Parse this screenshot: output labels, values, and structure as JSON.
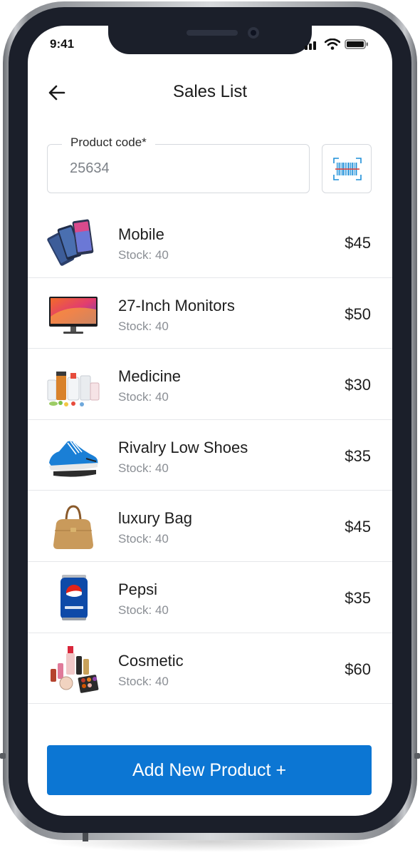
{
  "status_bar": {
    "time": "9:41"
  },
  "header": {
    "title": "Sales List"
  },
  "product_code": {
    "label": "Product code*",
    "value": "25634"
  },
  "products": [
    {
      "name": "Mobile",
      "stock": "Stock: 40",
      "price": "$45",
      "icon": "mobile-phones-image"
    },
    {
      "name": "27-Inch Monitors",
      "stock": "Stock: 40",
      "price": "$50",
      "icon": "monitor-image"
    },
    {
      "name": "Medicine",
      "stock": "Stock: 40",
      "price": "$30",
      "icon": "medicine-image"
    },
    {
      "name": "Rivalry Low Shoes",
      "stock": "Stock: 40",
      "price": "$35",
      "icon": "shoes-image"
    },
    {
      "name": "luxury Bag",
      "stock": "Stock: 40",
      "price": "$45",
      "icon": "bag-image"
    },
    {
      "name": "Pepsi",
      "stock": "Stock: 40",
      "price": "$35",
      "icon": "pepsi-can-image"
    },
    {
      "name": "Cosmetic",
      "stock": "Stock: 40",
      "price": "$60",
      "icon": "cosmetics-image"
    }
  ],
  "actions": {
    "add_label": "Add New Product +"
  },
  "colors": {
    "primary": "#0c76d3",
    "frame": "#1b1f2a",
    "divider": "#e5e7ea"
  }
}
